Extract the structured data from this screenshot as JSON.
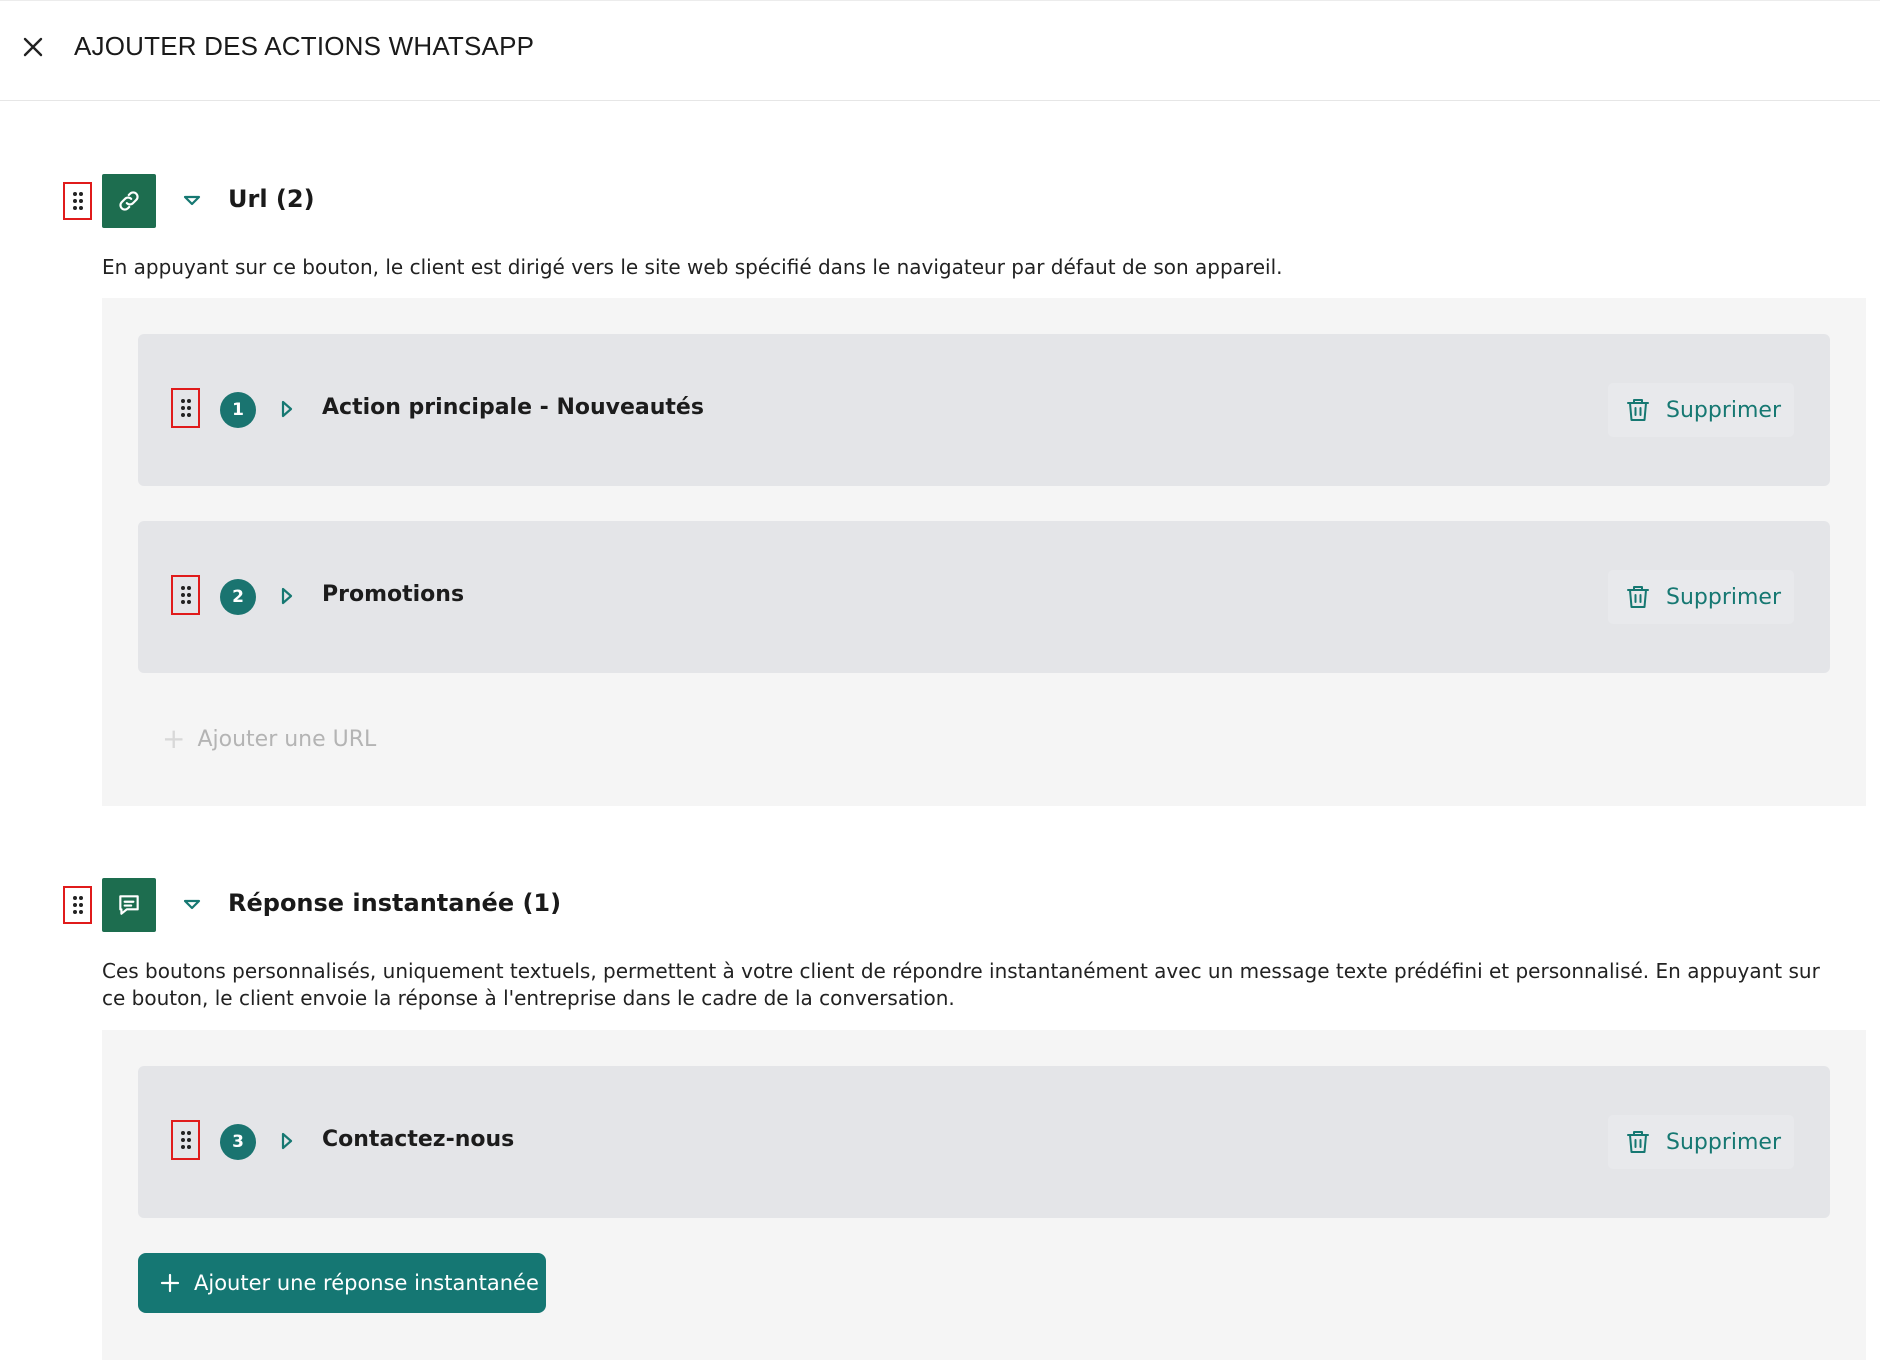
{
  "header": {
    "title": "AJOUTER DES ACTIONS WHATSAPP",
    "close_icon": "close-icon"
  },
  "colors": {
    "brand_green": "#1d6d4f",
    "teal": "#167872",
    "card_bg": "#e4e5e8",
    "panel_bg": "#f5f5f5",
    "drag_highlight": "#e01b1b"
  },
  "sections": [
    {
      "icon": "link-icon",
      "title": "Url (2)",
      "expanded": true,
      "description": "En appuyant sur ce bouton, le client est dirigé vers le site web spécifié dans le navigateur par défaut de son appareil.",
      "items": [
        {
          "number": "1",
          "label": "Action principale - Nouveautés",
          "delete_label": "Supprimer"
        },
        {
          "number": "2",
          "label": "Promotions",
          "delete_label": "Supprimer"
        }
      ],
      "add_label": "Ajouter une URL",
      "add_enabled": false
    },
    {
      "icon": "chat-icon",
      "title": "Réponse instantanée (1)",
      "expanded": true,
      "description": "Ces boutons personnalisés, uniquement textuels, permettent à votre client de répondre instantanément avec un message texte prédéfini et personnalisé. En appuyant sur ce bouton, le client envoie la réponse à l'entreprise dans le cadre de la conversation.",
      "items": [
        {
          "number": "3",
          "label": "Contactez-nous",
          "delete_label": "Supprimer"
        }
      ],
      "add_label": "Ajouter une réponse instantanée",
      "add_enabled": true
    }
  ]
}
